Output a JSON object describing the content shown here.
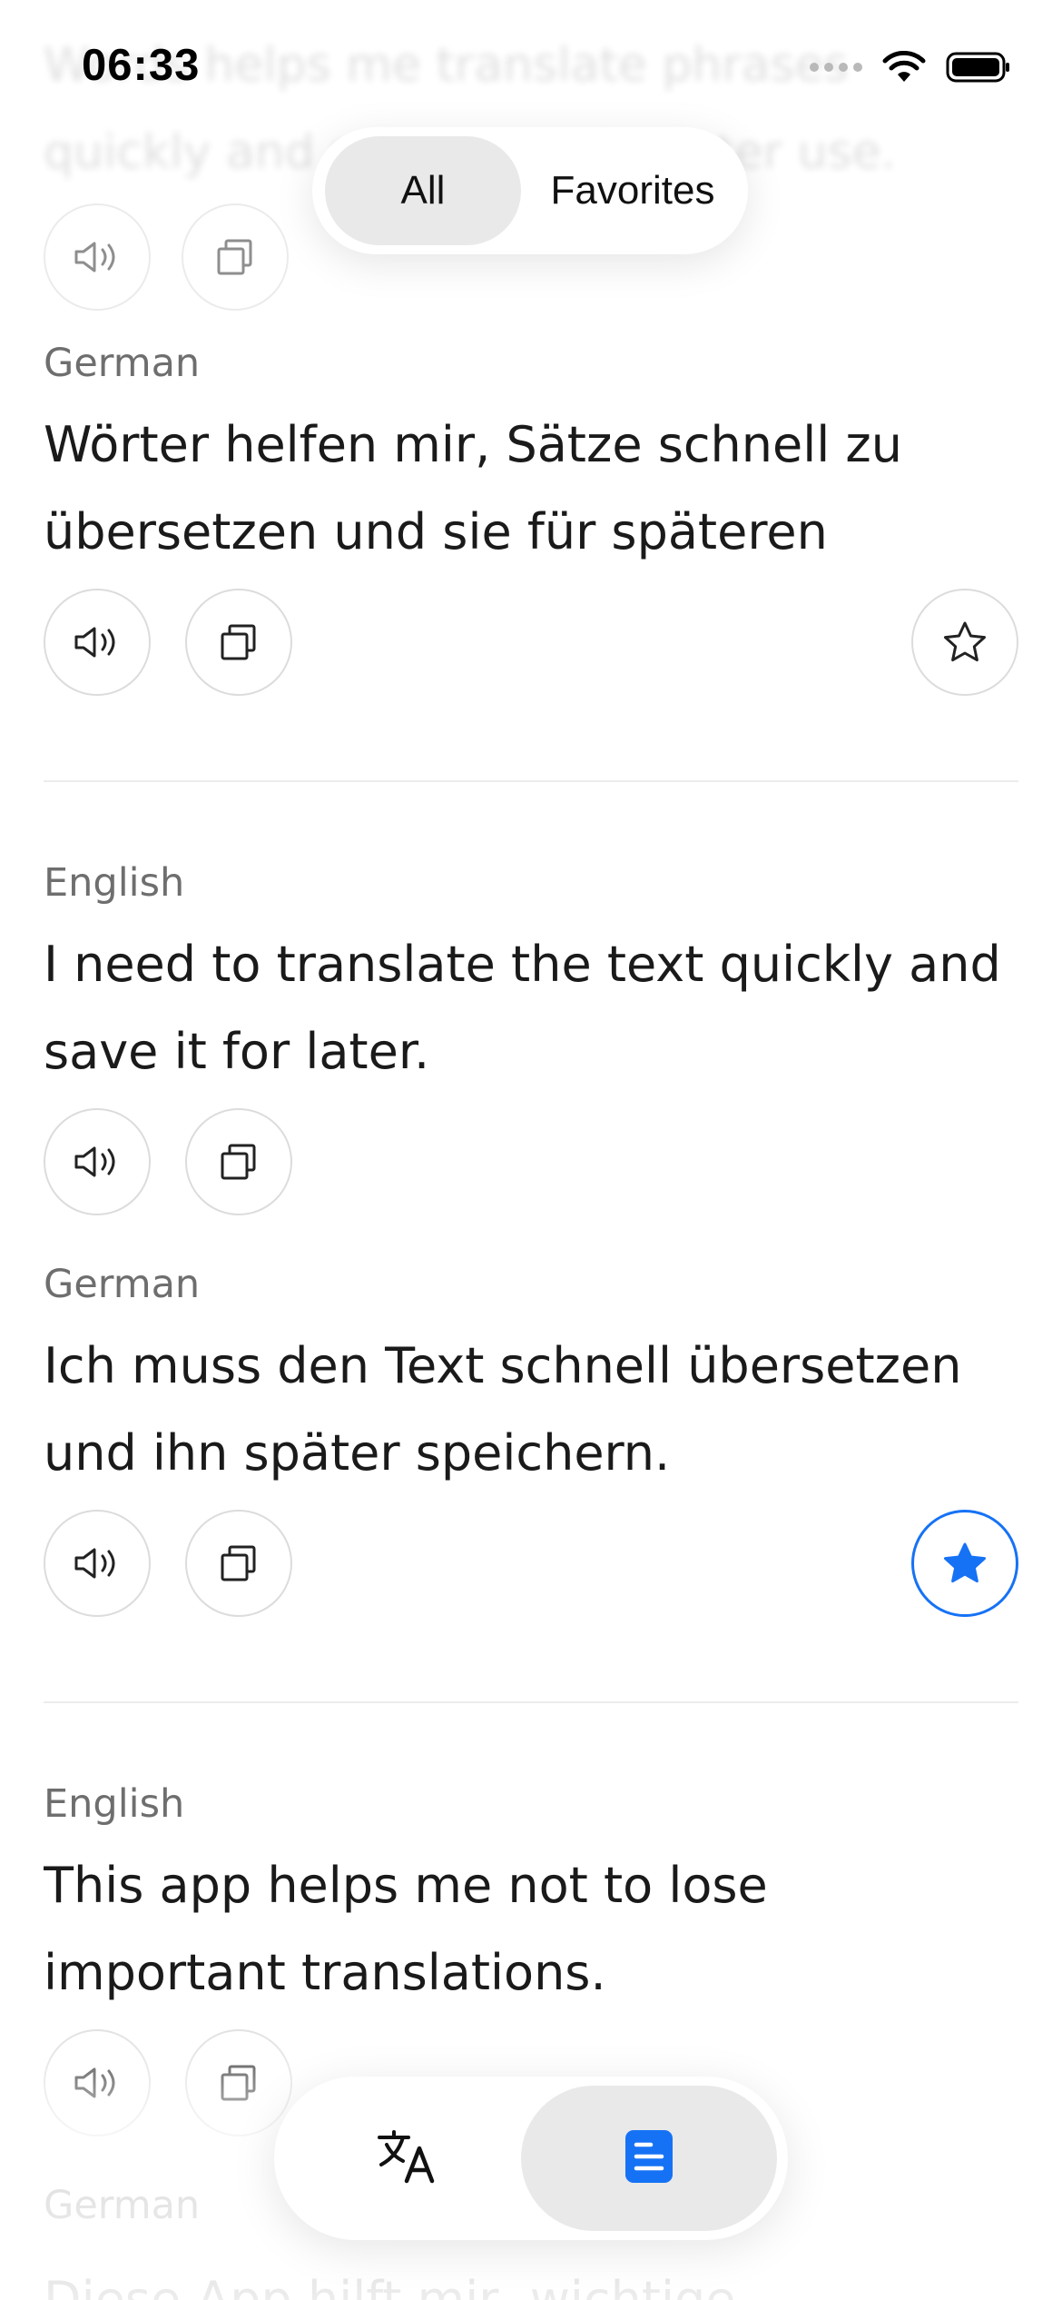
{
  "status_bar": {
    "time": "06:33",
    "signal_icon": "signal-dots-icon",
    "wifi_icon": "wifi-icon",
    "battery_icon": "battery-icon"
  },
  "segment_control": {
    "selected": "All",
    "options": [
      {
        "label": "All",
        "selected": true
      },
      {
        "label": "Favorites",
        "selected": false
      }
    ]
  },
  "faded_top": {
    "text": "Words helps me translate phrases quickly and save them for later use."
  },
  "entries": [
    {
      "language": "German",
      "text": "Wörter helfen mir, Sätze schnell zu übersetzen und sie für späteren Gebra…",
      "favorite": false,
      "speaker_icon": "speaker-icon",
      "copy_icon": "copy-icon",
      "star_icon": "star-outline-icon"
    },
    {
      "language": "English",
      "text": "I need to translate the text quickly and save it for later.",
      "speaker_icon": "speaker-icon",
      "copy_icon": "copy-icon"
    },
    {
      "language": "German",
      "text": "Ich muss den Text schnell übersetzen und ihn später speichern.",
      "favorite": true,
      "speaker_icon": "speaker-icon",
      "copy_icon": "copy-icon",
      "star_icon": "star-filled-icon"
    },
    {
      "language": "English",
      "text": "This app helps me not to lose important translations.",
      "speaker_icon": "speaker-icon",
      "copy_icon": "copy-icon"
    },
    {
      "language": "German",
      "text": "Diese App hilft mir, wichtige"
    }
  ],
  "tab_bar": {
    "items": [
      {
        "name": "translate",
        "icon": "translate-icon",
        "selected": false
      },
      {
        "name": "saved",
        "icon": "document-icon",
        "selected": true
      }
    ]
  },
  "colors": {
    "accent": "#1672f5",
    "background": "#ffffff",
    "text": "#1a1a1a",
    "muted_text": "#6e6e6e",
    "button_border": "#dcdcdc",
    "selected_pill": "#e9e9e9"
  }
}
